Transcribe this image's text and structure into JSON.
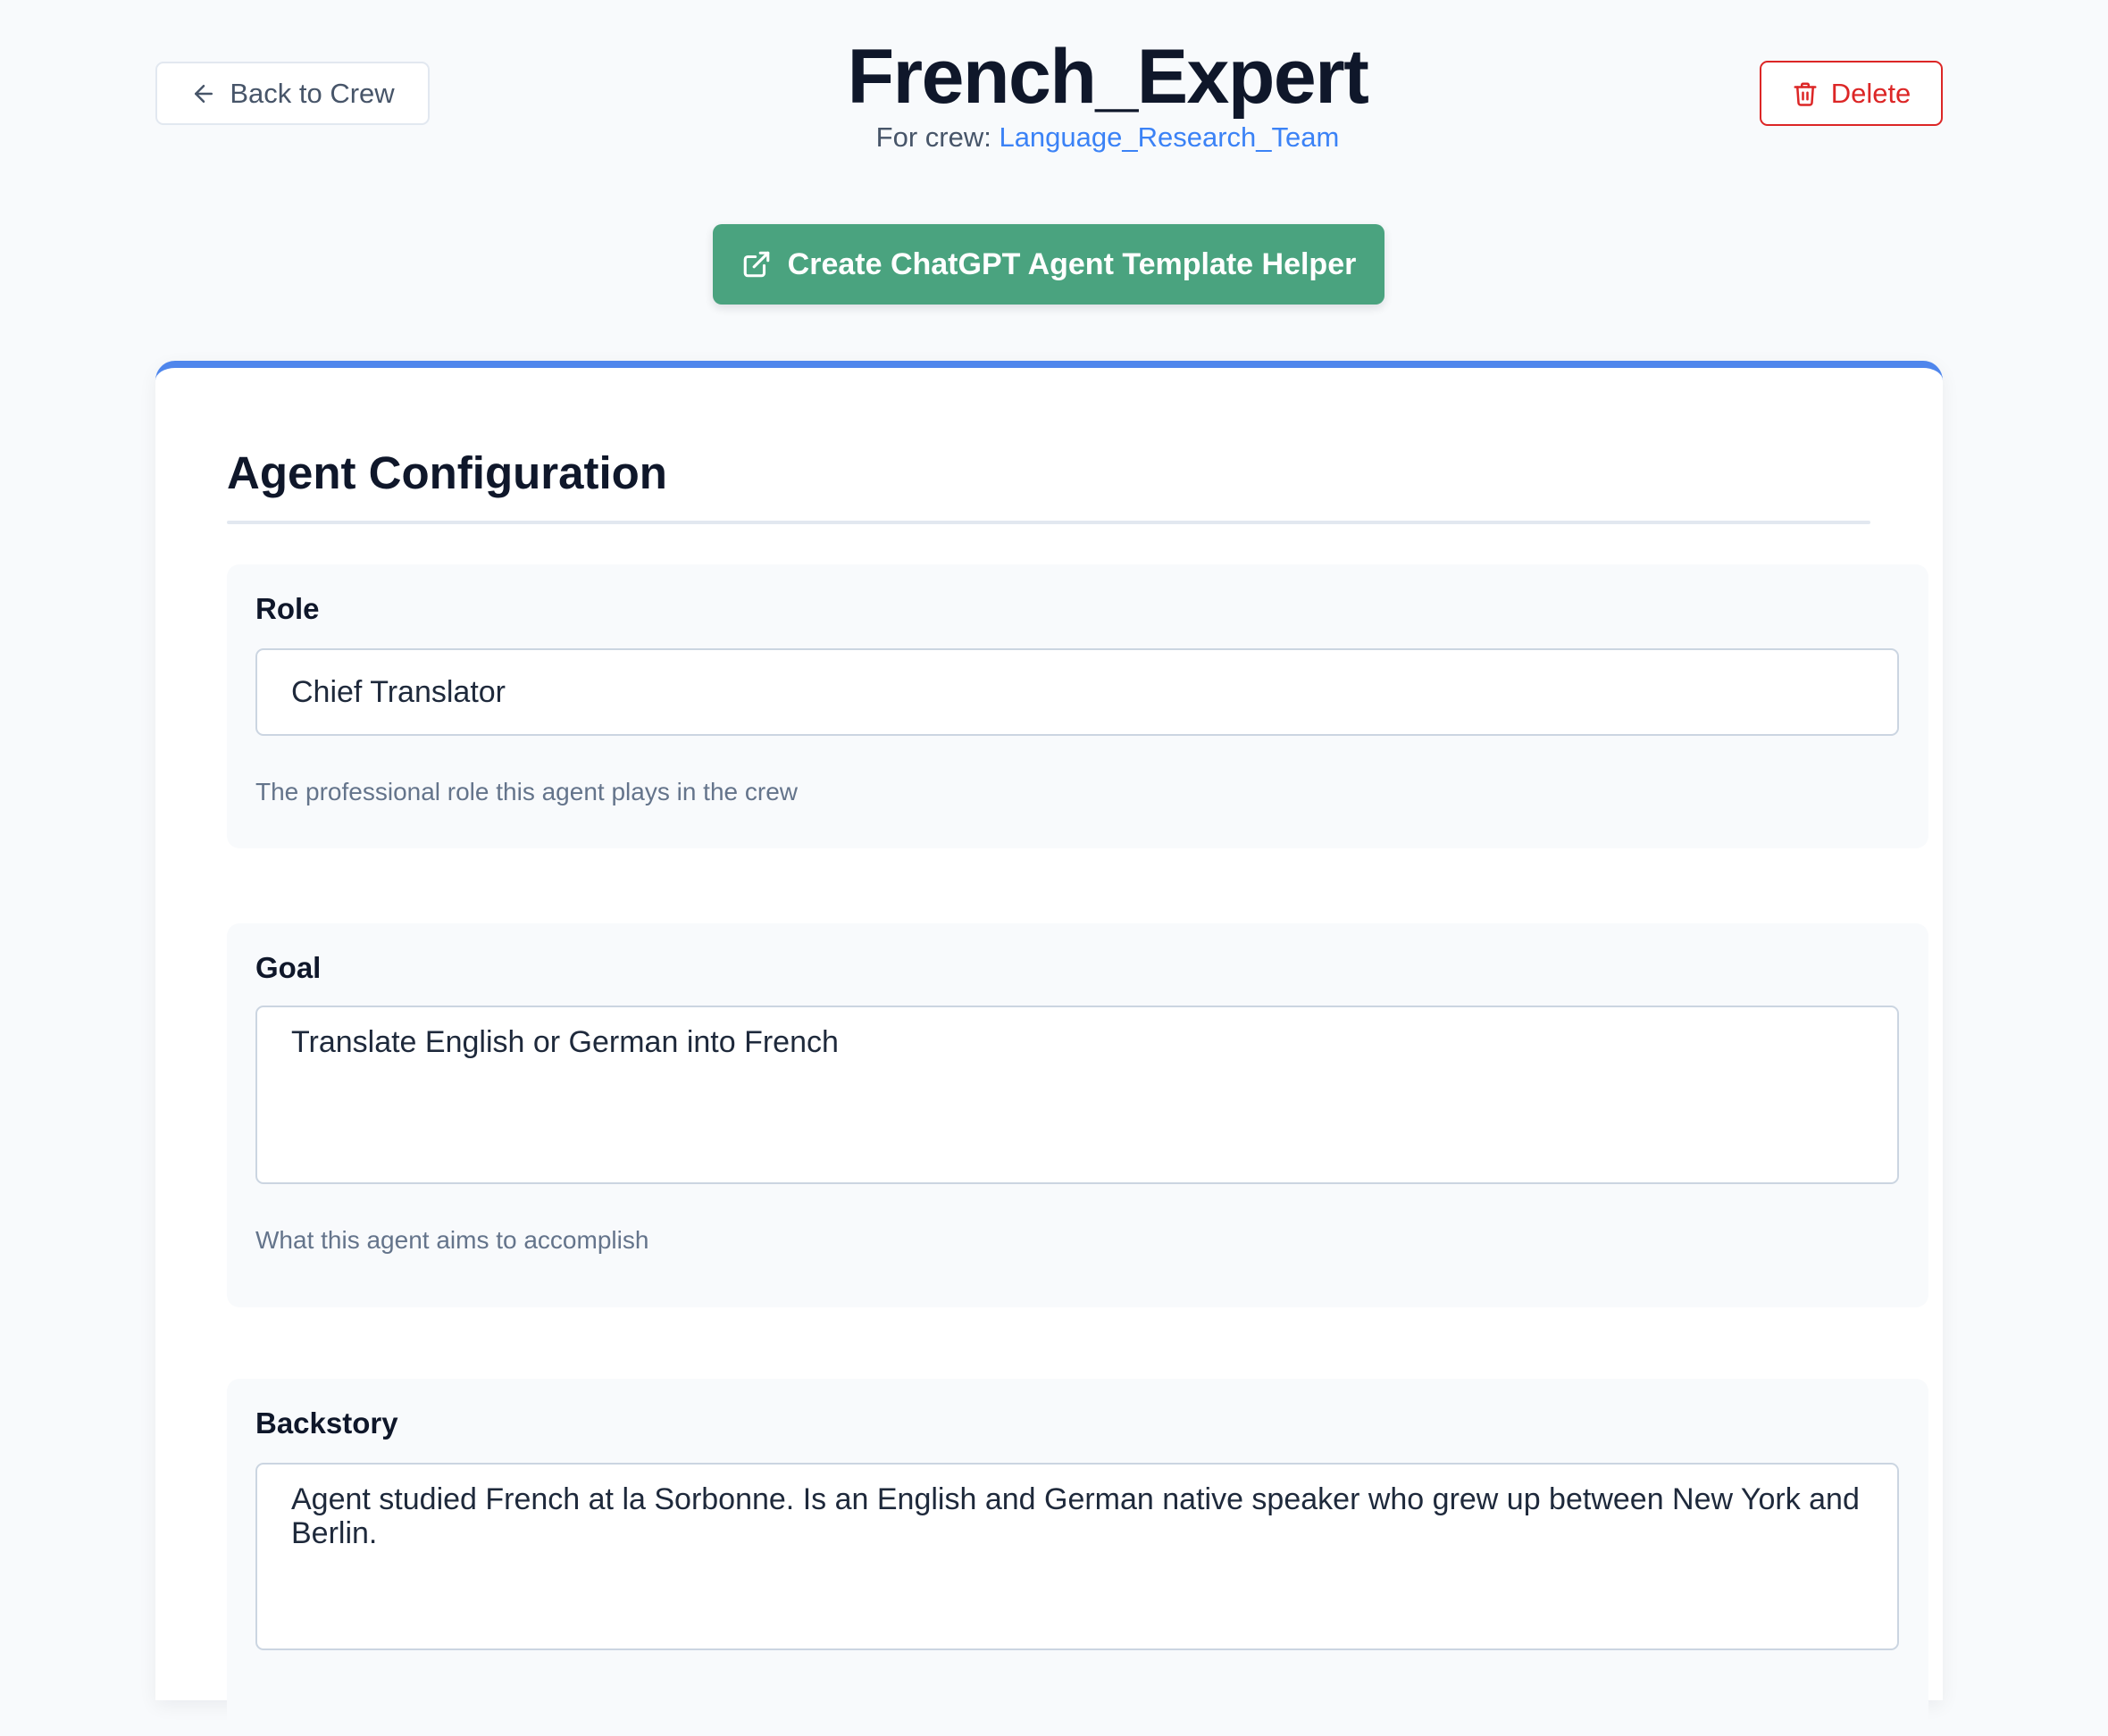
{
  "header": {
    "back_label": "Back to Crew",
    "title": "French_Expert",
    "crew_prefix": "For crew:",
    "crew_name": "Language_Research_Team",
    "delete_label": "Delete",
    "helper_label": "Create ChatGPT Agent Template Helper"
  },
  "config": {
    "section_title": "Agent Configuration",
    "fields": [
      {
        "label": "Role",
        "value": "Chief Translator",
        "help": "The professional role this agent plays in the crew"
      },
      {
        "label": "Goal",
        "value": "Translate English or German into French",
        "help": "What this agent aims to accomplish"
      },
      {
        "label": "Backstory",
        "value": "Agent studied French at la Sorbonne. Is an English and German native speaker who grew up between New York and Berlin.",
        "help": ""
      }
    ]
  },
  "colors": {
    "accent_blue": "#4f86ec",
    "helper_green": "#4aa37f",
    "danger_red": "#dc2626",
    "background": "#f8fafc"
  },
  "icons": {
    "back": "arrow-left-icon",
    "delete": "trash-icon",
    "helper": "external-link-icon"
  }
}
